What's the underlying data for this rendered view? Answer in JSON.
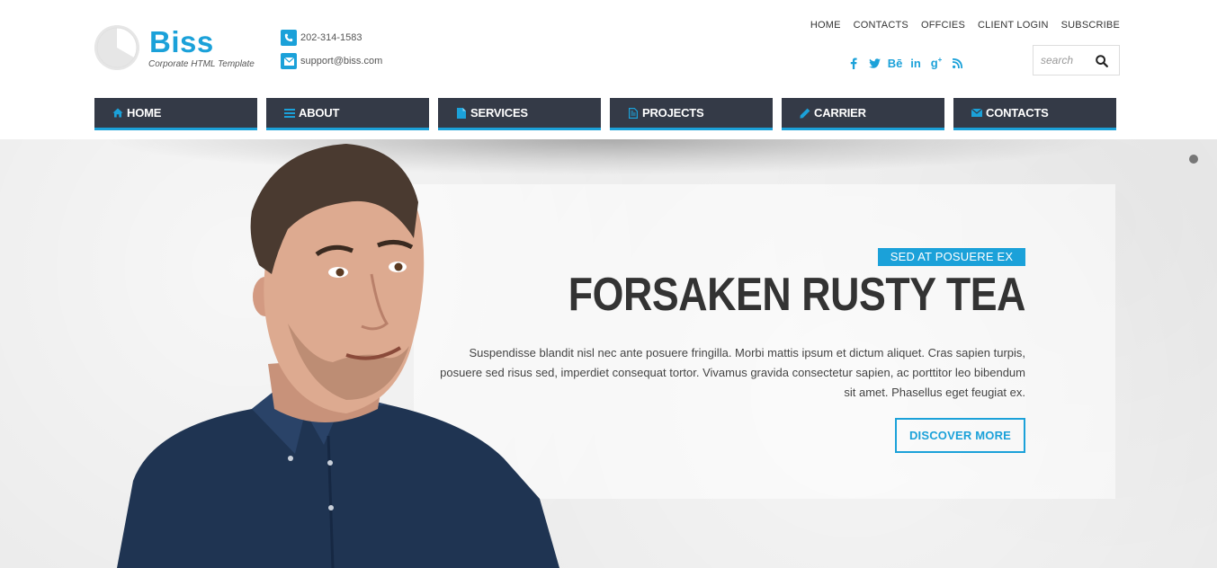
{
  "brand": {
    "name": "Biss",
    "tagline": "Corporate HTML Template"
  },
  "contact": {
    "phone": "202-314-1583",
    "email": "support@biss.com"
  },
  "top_nav": [
    {
      "label": "HOME"
    },
    {
      "label": "CONTACTS"
    },
    {
      "label": "OFFCIES"
    },
    {
      "label": "CLIENT LOGIN"
    },
    {
      "label": "SUBSCRIBE"
    }
  ],
  "social": [
    {
      "icon": "facebook-icon",
      "glyph": "f"
    },
    {
      "icon": "twitter-icon",
      "glyph": "t"
    },
    {
      "icon": "behance-icon",
      "glyph": "Bē"
    },
    {
      "icon": "linkedin-icon",
      "glyph": "in"
    },
    {
      "icon": "google-plus-icon",
      "glyph": "g+"
    },
    {
      "icon": "rss-icon",
      "glyph": "rss"
    }
  ],
  "search": {
    "placeholder": "search",
    "value": ""
  },
  "main_nav": [
    {
      "label": "HOME",
      "icon": "home-icon"
    },
    {
      "label": "ABOUT",
      "icon": "menu-icon"
    },
    {
      "label": "SERVICES",
      "icon": "file-icon"
    },
    {
      "label": "PROJECTS",
      "icon": "document-icon"
    },
    {
      "label": "CARRIER",
      "icon": "pencil-icon"
    },
    {
      "label": "CONTACTS",
      "icon": "envelope-icon"
    }
  ],
  "hero": {
    "label": "SED AT POSUERE EX",
    "title": "FORSAKEN RUSTY TEA",
    "text": "Suspendisse blandit nisl nec ante posuere fringilla. Morbi mattis ipsum et dictum aliquet. Cras sapien turpis, posuere sed risus sed, imperdiet consequat tortor. Vivamus gravida consectetur sapien, ac porttitor leo bibendum sit amet. Phasellus eget feugiat ex.",
    "button": "DISCOVER MORE"
  },
  "colors": {
    "accent": "#1ba1d9",
    "nav_bg": "#343a47",
    "hero_bg": "#ebebeb",
    "heading": "#333333"
  }
}
